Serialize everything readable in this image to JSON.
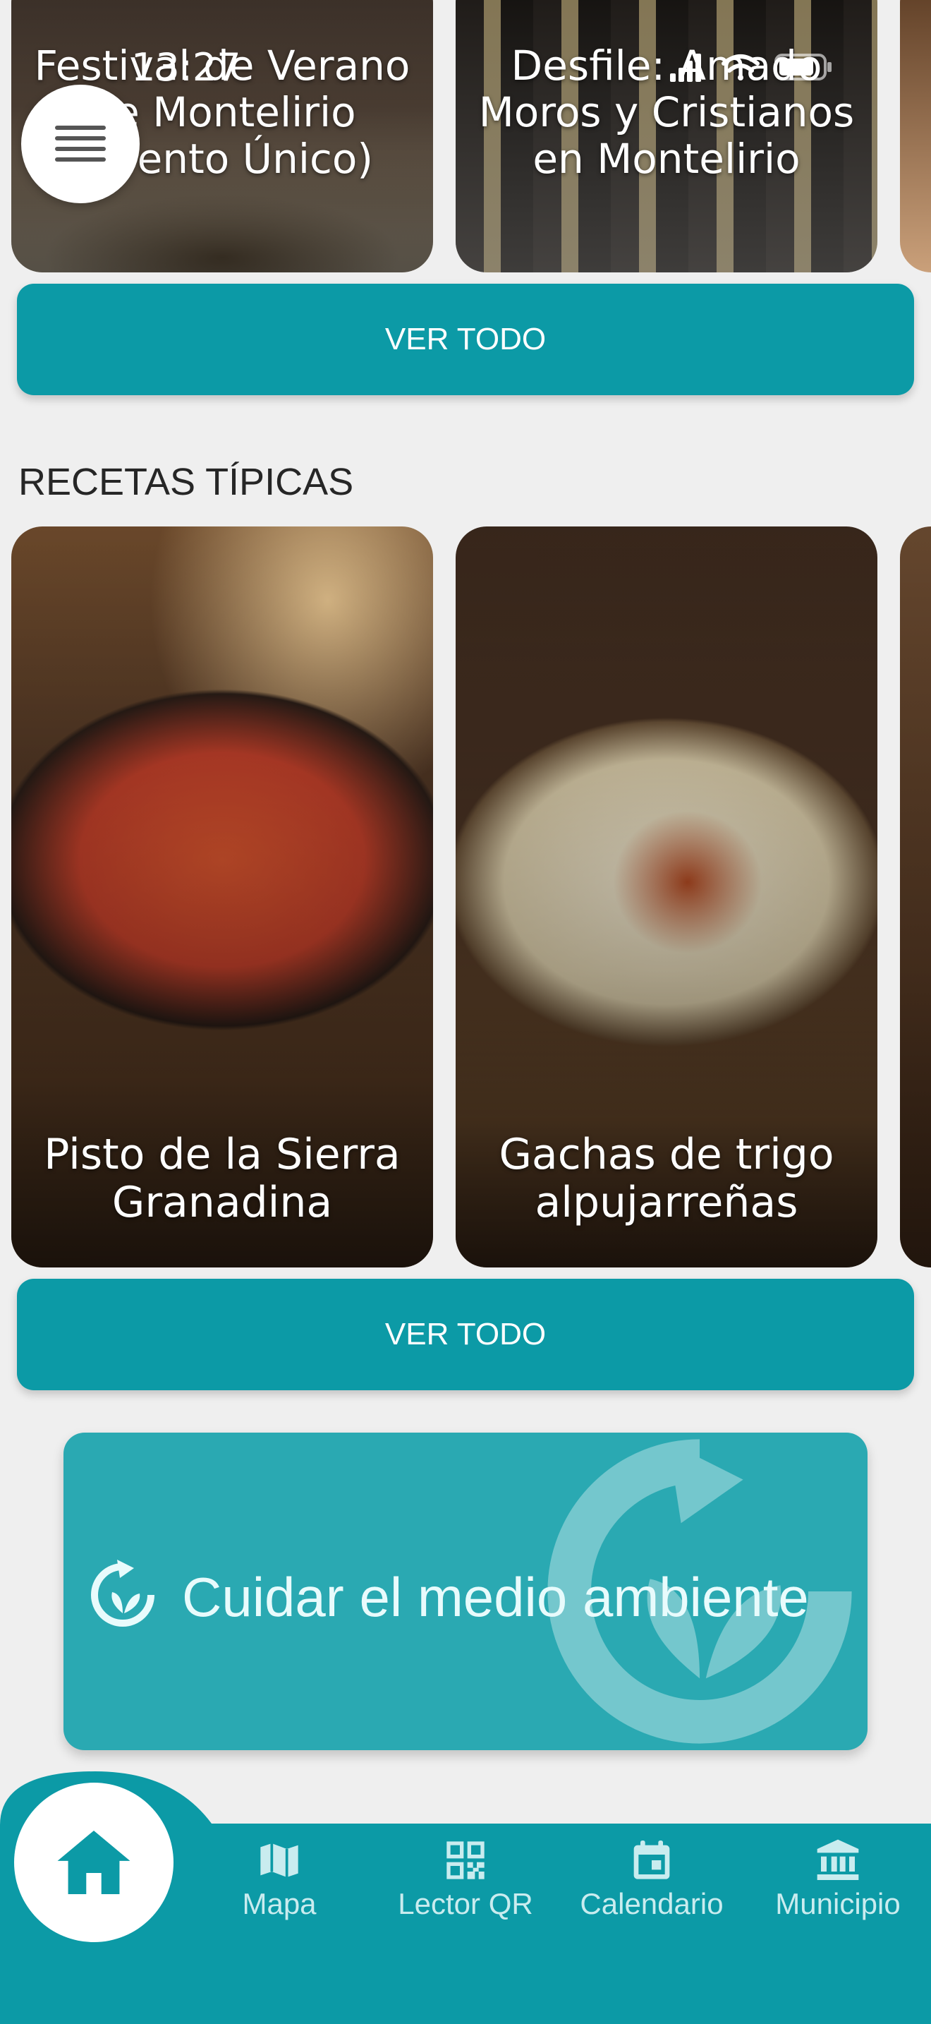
{
  "status_bar": {
    "time": "13:27"
  },
  "events": {
    "cards": [
      {
        "title": "Festival de Verano de Montelirio (Evento Único)"
      },
      {
        "title": "Desfile: Amado Moros y Cristianos en Montelirio"
      }
    ],
    "see_all_label": "VER TODO"
  },
  "recipes": {
    "section_title": "RECETAS TÍPICAS",
    "cards": [
      {
        "title": "Pisto de la Sierra Granadina"
      },
      {
        "title": "Gachas de trigo alpujarreñas"
      }
    ],
    "see_all_label": "VER TODO"
  },
  "environment_banner": {
    "label": "Cuidar el medio ambiente",
    "icon": "eco-recycle-icon"
  },
  "bottom_nav": {
    "items": [
      {
        "label": "",
        "icon": "home-icon"
      },
      {
        "label": "Mapa",
        "icon": "map-icon"
      },
      {
        "label": "Lector QR",
        "icon": "qr-code-icon"
      },
      {
        "label": "Calendario",
        "icon": "calendar-icon"
      },
      {
        "label": "Municipio",
        "icon": "bank-icon"
      }
    ]
  },
  "colors": {
    "primary": "#0c9aa6",
    "banner": "#2aa9b2",
    "background": "#efefef",
    "nav_text": "#c9ecef"
  }
}
